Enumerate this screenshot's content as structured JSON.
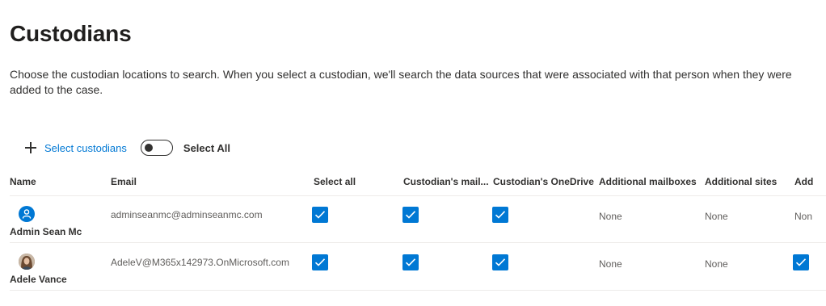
{
  "page": {
    "title": "Custodians",
    "description": "Choose the custodian locations to search. When you select a custodian, we'll search the data sources that were associated with that person when they were added to the case."
  },
  "toolbar": {
    "select_custodians_label": "Select custodians",
    "select_all_toggle": {
      "label": "Select All",
      "on": false
    }
  },
  "table": {
    "columns": [
      "Name",
      "Email",
      "Select all",
      "Custodian's mail...",
      "Custodian's OneDrive",
      "Additional mailboxes",
      "Additional sites",
      "Add"
    ],
    "rows": [
      {
        "name": "Admin Sean Mc",
        "email": "adminseanmc@adminseanmc.com",
        "select_all": true,
        "mailbox": true,
        "onedrive": true,
        "additional_mailboxes": "None",
        "additional_sites": "None",
        "add_partial": "Non"
      },
      {
        "name": "Adele Vance",
        "email": "AdeleV@M365x142973.OnMicrosoft.com",
        "select_all": true,
        "mailbox": true,
        "onedrive": true,
        "additional_mailboxes": "None",
        "additional_sites": "None",
        "add_checked": true
      }
    ]
  },
  "colors": {
    "accent": "#0078d4",
    "text": "#323130",
    "secondary_text": "#605e5c",
    "divider": "#edebe9"
  }
}
